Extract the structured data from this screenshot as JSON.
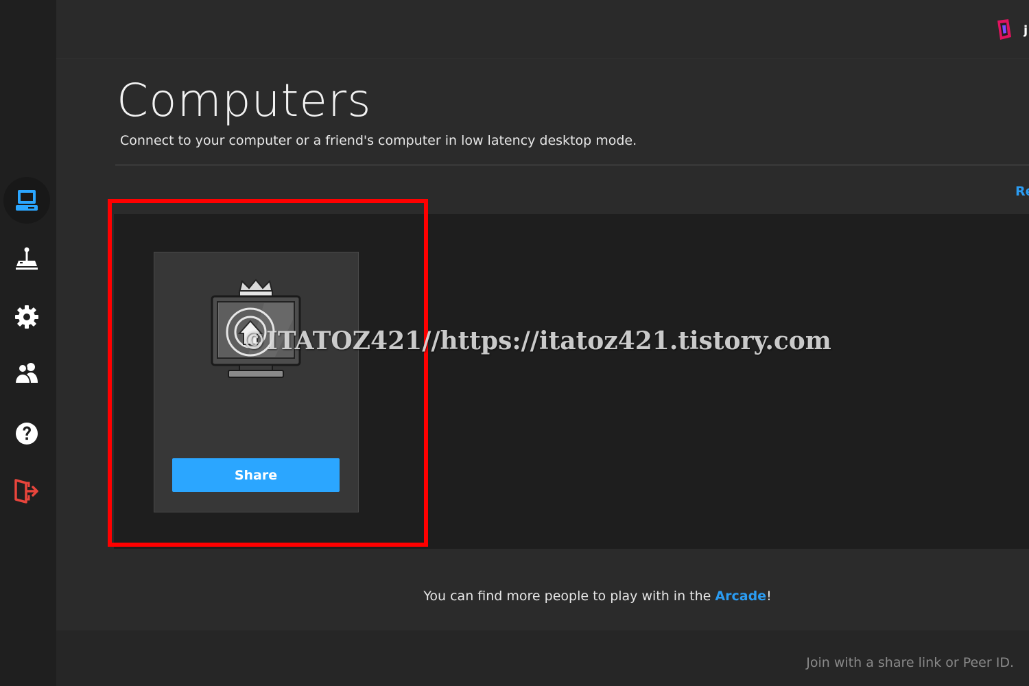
{
  "topbar": {
    "user_initial": "j"
  },
  "main": {
    "title": "Computers",
    "subtitle": "Connect to your computer or a friend's computer in low latency desktop mode.",
    "refresh_label": "Re",
    "card": {
      "share_label": "Share"
    },
    "footer_prefix": "You can find more people to play with in the ",
    "footer_link": "Arcade",
    "footer_suffix": "!",
    "join_label": "Join with a share link or Peer ID."
  },
  "sidebar": {
    "items": [
      {
        "icon": "computer-icon",
        "active": true
      },
      {
        "icon": "joystick-icon",
        "active": false
      },
      {
        "icon": "gear-icon",
        "active": false
      },
      {
        "icon": "friends-icon",
        "active": false
      },
      {
        "icon": "help-icon",
        "active": false
      },
      {
        "icon": "logout-icon",
        "active": false
      }
    ]
  },
  "watermark": "©ITATOZ421//https://itatoz421.tistory.com",
  "colors": {
    "accent": "#2b9cf2",
    "button": "#2ba6ff",
    "highlight": "#ff0000",
    "logout": "#e8453c"
  }
}
